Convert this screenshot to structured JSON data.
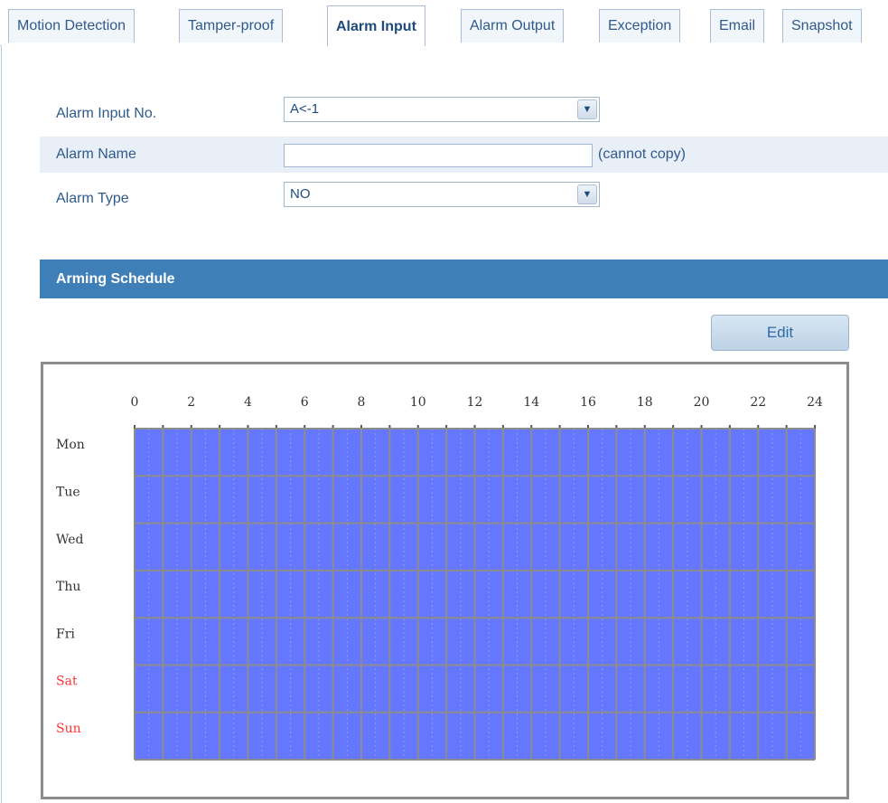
{
  "tabs": [
    {
      "label": "Motion Detection",
      "active": false
    },
    {
      "label": "Tamper-proof",
      "active": false
    },
    {
      "label": "Alarm Input",
      "active": true
    },
    {
      "label": "Alarm Output",
      "active": false
    },
    {
      "label": "Exception",
      "active": false
    },
    {
      "label": "Email",
      "active": false
    },
    {
      "label": "Snapshot",
      "active": false
    }
  ],
  "form": {
    "alarm_input_no": {
      "label": "Alarm Input No.",
      "value": "A<-1"
    },
    "alarm_name": {
      "label": "Alarm Name",
      "value": "",
      "hint": "(cannot copy)"
    },
    "alarm_type": {
      "label": "Alarm Type",
      "value": "NO"
    }
  },
  "arming_schedule": {
    "title": "Arming Schedule",
    "edit_label": "Edit",
    "hour_ticks": [
      "0",
      "2",
      "4",
      "6",
      "8",
      "10",
      "12",
      "14",
      "16",
      "18",
      "20",
      "22",
      "24"
    ],
    "days": [
      {
        "label": "Mon",
        "weekend": false,
        "armed_ranges": [
          [
            0,
            24
          ]
        ]
      },
      {
        "label": "Tue",
        "weekend": false,
        "armed_ranges": [
          [
            0,
            24
          ]
        ]
      },
      {
        "label": "Wed",
        "weekend": false,
        "armed_ranges": [
          [
            0,
            24
          ]
        ]
      },
      {
        "label": "Thu",
        "weekend": false,
        "armed_ranges": [
          [
            0,
            24
          ]
        ]
      },
      {
        "label": "Fri",
        "weekend": false,
        "armed_ranges": [
          [
            0,
            24
          ]
        ]
      },
      {
        "label": "Sat",
        "weekend": true,
        "armed_ranges": [
          [
            0,
            24
          ]
        ]
      },
      {
        "label": "Sun",
        "weekend": true,
        "armed_ranges": [
          [
            0,
            24
          ]
        ]
      }
    ],
    "colors": {
      "armed": "#6677ff",
      "grid": "#8c8c8c",
      "weekday_text": "#333333",
      "weekend_text": "#ff3333"
    }
  }
}
